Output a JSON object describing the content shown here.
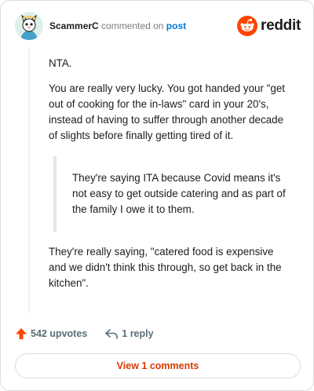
{
  "comment": {
    "username": "ScammerC",
    "verb": "commented on",
    "target_link": "post",
    "brand": "reddit",
    "paragraphs_before_quote": [
      "NTA.",
      "You are really very lucky. You got handed your \"get out of cooking for the in-laws\" card in your 20's, instead of having to suffer through another decade of slights before finally getting tired of it."
    ],
    "quote": "They're saying ITA because Covid means it's not easy to get outside catering and as part of the family I owe it to them.",
    "paragraphs_after_quote": [
      "They're really saying, \"catered food is expensive and we didn't think this through, so get back in the kitchen\"."
    ]
  },
  "footer": {
    "upvotes": "542 upvotes",
    "replies": "1 reply",
    "view_button": "View 1 comments"
  },
  "colors": {
    "brand_orange": "#ff4500",
    "link_blue": "#0079d3",
    "view_button_text": "#d93a00",
    "meta_gray": "#7c7c7c"
  },
  "icons": [
    "avatar",
    "reddit-logo-icon",
    "upvote-arrow-icon",
    "reply-icon"
  ]
}
